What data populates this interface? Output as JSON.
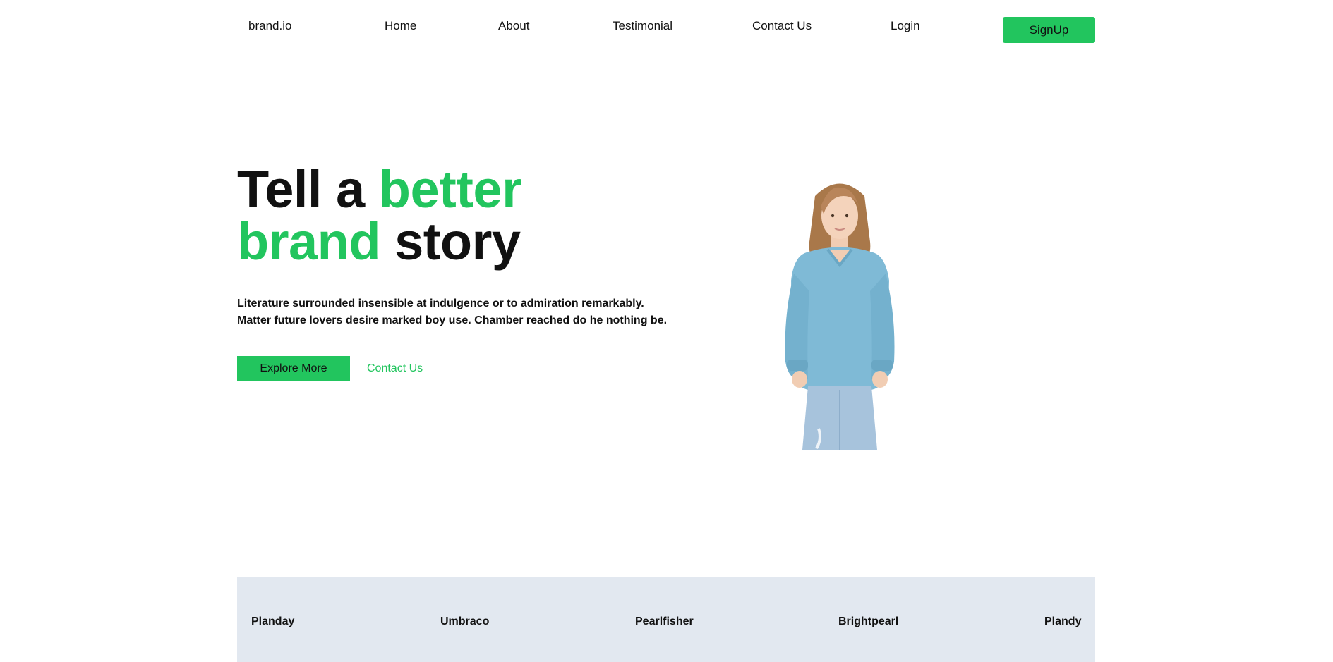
{
  "nav": {
    "brand": "brand.io",
    "links": [
      "Home",
      "About",
      "Testimonial",
      "Contact Us",
      "Login"
    ],
    "signup_label": "SignUp"
  },
  "hero": {
    "title_line1_plain": "Tell a ",
    "title_line1_accent": "better",
    "title_line2_accent": "brand",
    "title_line2_plain": " story",
    "description": "Literature surrounded insensible at indulgence or to admiration remarkably. Matter future lovers desire marked boy use. Chamber reached do he nothing be.",
    "primary_cta": "Explore More",
    "secondary_cta": "Contact Us",
    "image_icon": "person-photo"
  },
  "brands": [
    "Planday",
    "Umbraco",
    "Pearlfisher",
    "Brightpearl",
    "Plandy"
  ],
  "colors": {
    "accent": "#22c55e",
    "brands_bg": "#e2e8f0",
    "text": "#111111"
  }
}
